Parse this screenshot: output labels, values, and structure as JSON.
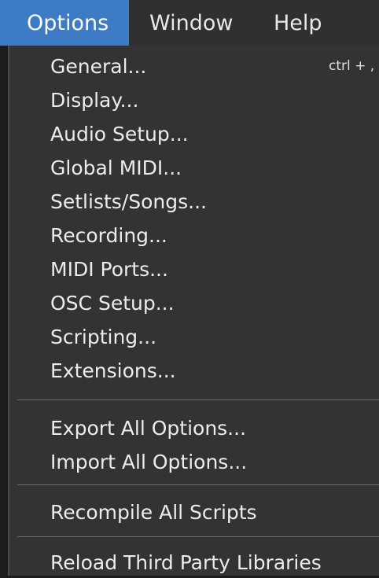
{
  "menubar": {
    "items": [
      {
        "label": "Options",
        "active": true
      },
      {
        "label": "Window",
        "active": false
      },
      {
        "label": "Help",
        "active": false
      }
    ]
  },
  "options_menu": {
    "groups": [
      {
        "items": [
          {
            "label": "General...",
            "shortcut": "ctrl + ,"
          },
          {
            "label": "Display..."
          },
          {
            "label": "Audio Setup..."
          },
          {
            "label": "Global MIDI..."
          },
          {
            "label": "Setlists/Songs..."
          },
          {
            "label": "Recording..."
          },
          {
            "label": "MIDI Ports..."
          },
          {
            "label": "OSC Setup..."
          },
          {
            "label": "Scripting..."
          },
          {
            "label": "Extensions..."
          }
        ]
      },
      {
        "items": [
          {
            "label": "Export All Options..."
          },
          {
            "label": "Import All Options..."
          }
        ]
      },
      {
        "items": [
          {
            "label": "Recompile All Scripts"
          }
        ]
      },
      {
        "items": [
          {
            "label": "Reload Third Party Libraries"
          }
        ]
      }
    ]
  },
  "colors": {
    "menubar_bg": "#303030",
    "active_bg": "#3d7cc4",
    "menu_bg": "#333333",
    "text": "#ececec",
    "separator": "#6a6a6a"
  }
}
